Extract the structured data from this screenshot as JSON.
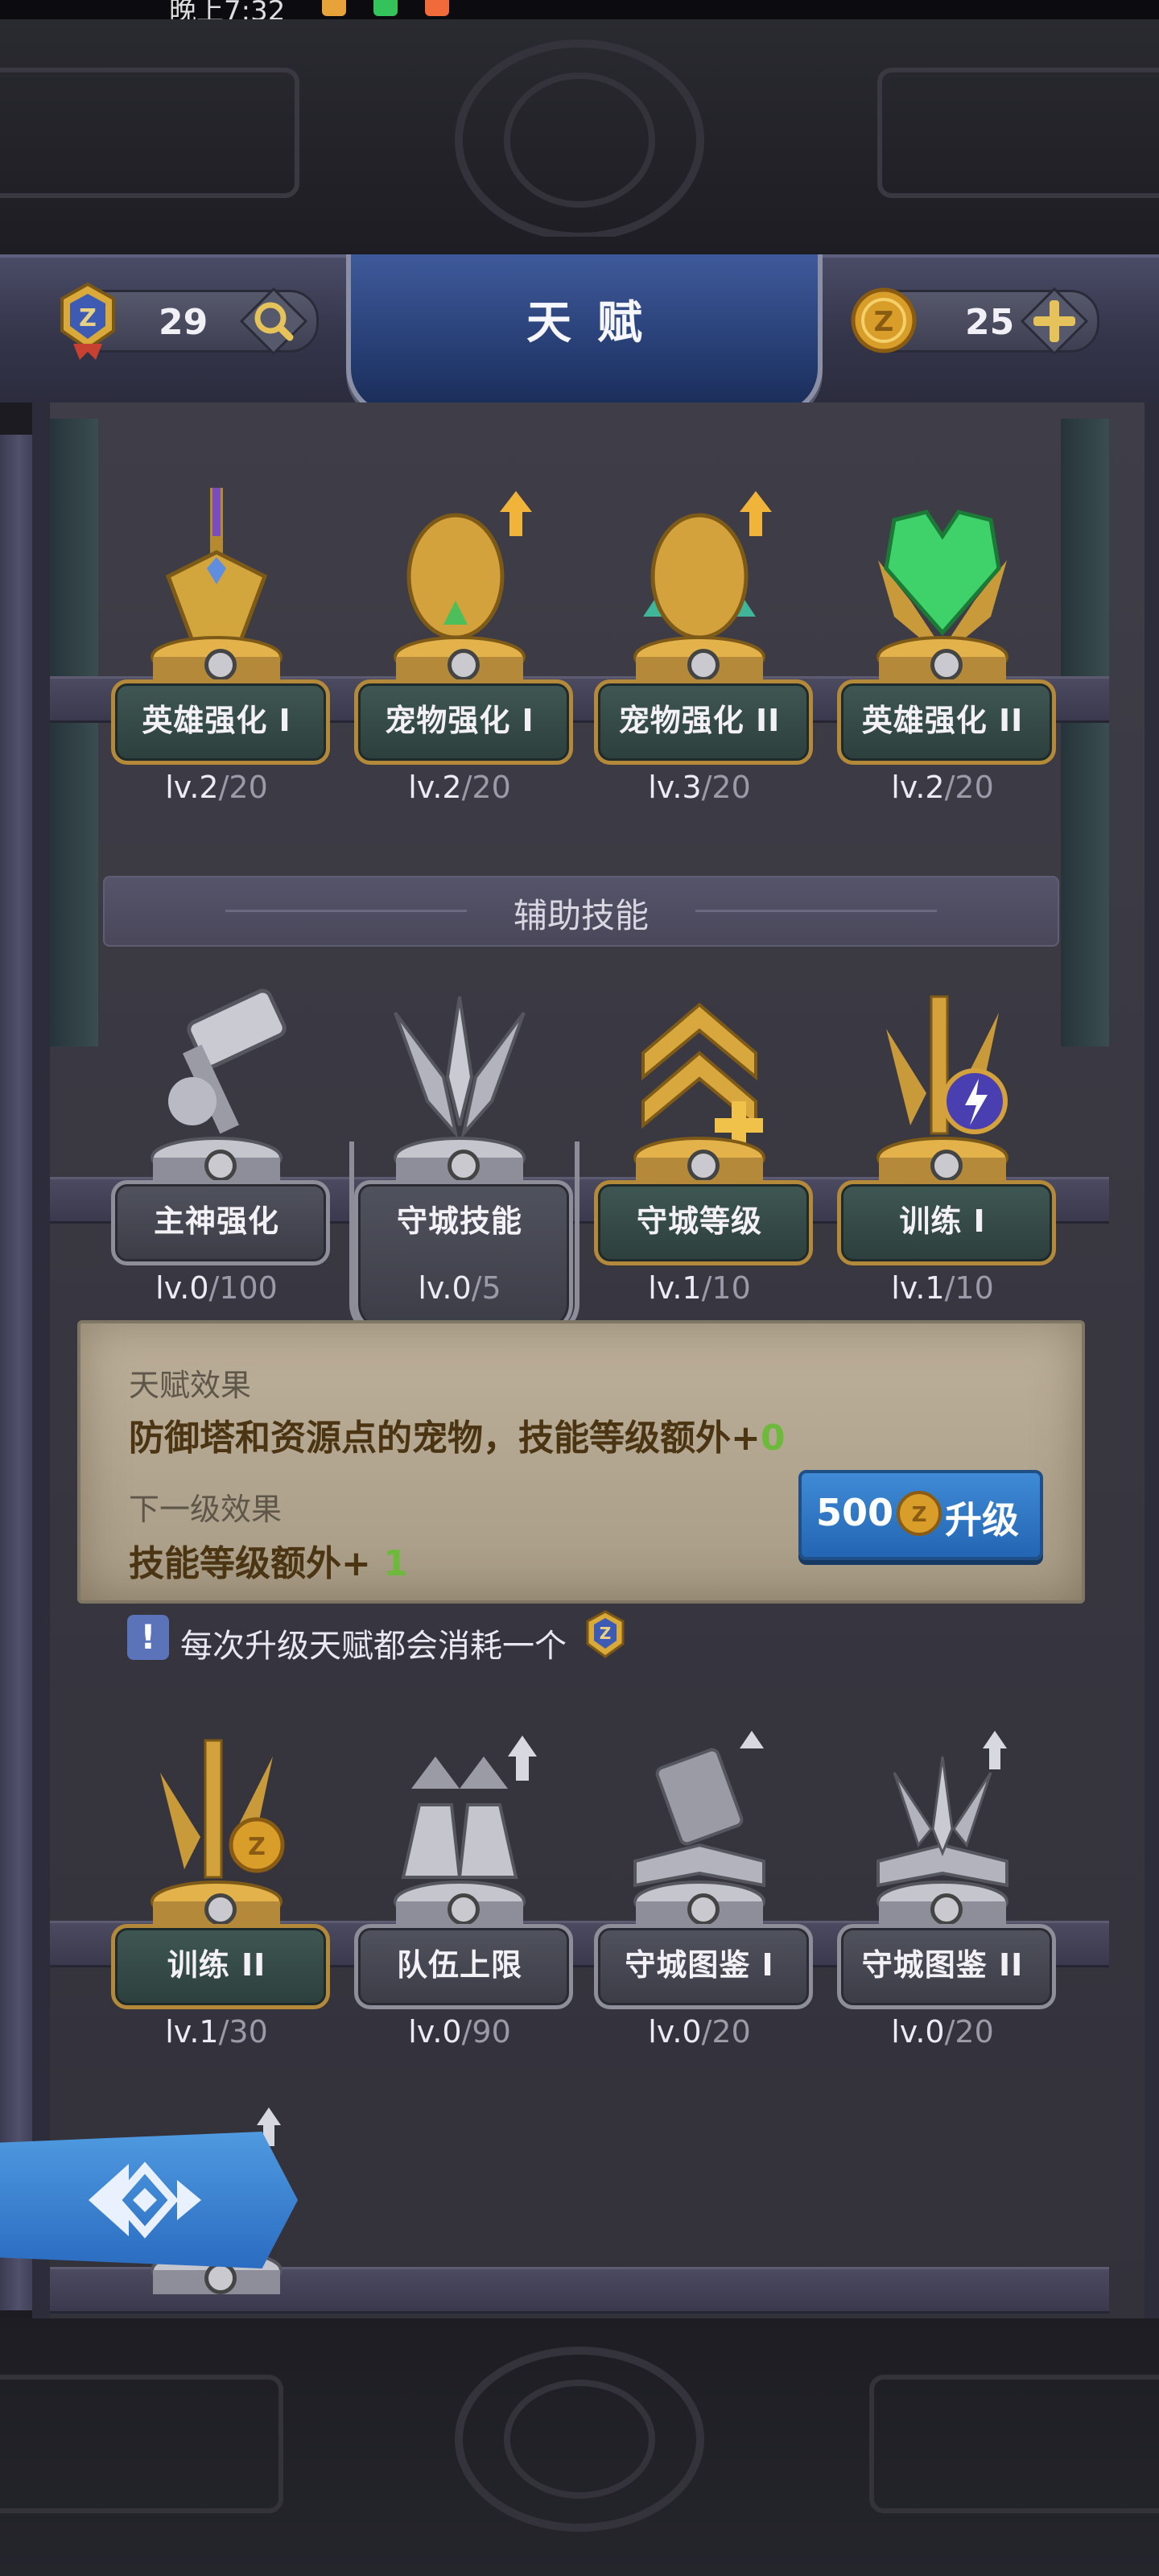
{
  "status_bar": {
    "time": "晚上7:32"
  },
  "header": {
    "title": "天赋",
    "talent_points": "29",
    "coins": "25"
  },
  "row1": [
    {
      "name": "英雄强化 I",
      "cur": "lv.2",
      "max": "/20"
    },
    {
      "name": "宠物强化 I",
      "cur": "lv.2",
      "max": "/20"
    },
    {
      "name": "宠物强化 II",
      "cur": "lv.3",
      "max": "/20"
    },
    {
      "name": "英雄强化 II",
      "cur": "lv.2",
      "max": "/20"
    }
  ],
  "section_title": "辅助技能",
  "row2": [
    {
      "name": "主神强化",
      "cur": "lv.0",
      "max": "/100"
    },
    {
      "name": "守城技能",
      "cur": "lv.0",
      "max": "/5"
    },
    {
      "name": "守城等级",
      "cur": "lv.1",
      "max": "/10"
    },
    {
      "name": "训练 I",
      "cur": "lv.1",
      "max": "/10"
    }
  ],
  "detail": {
    "effect_caption": "天赋效果",
    "effect_text": "防御塔和资源点的宠物，技能等级额外+",
    "effect_value": "0",
    "next_caption": "下一级效果",
    "next_text": "技能等级额外+ ",
    "next_value": "1",
    "upgrade_cost": "500",
    "upgrade_label": "升级"
  },
  "notice": "每次升级天赋都会消耗一个",
  "row3": [
    {
      "name": "训练 II",
      "cur": "lv.1",
      "max": "/30"
    },
    {
      "name": "队伍上限",
      "cur": "lv.0",
      "max": "/90"
    },
    {
      "name": "守城图鉴 I",
      "cur": "lv.0",
      "max": "/20"
    },
    {
      "name": "守城图鉴 II",
      "cur": "lv.0",
      "max": "/20"
    }
  ],
  "colors": {
    "gold": "#b48a3a",
    "accent_blue": "#2f74c4",
    "green_value": "#6db93c"
  }
}
